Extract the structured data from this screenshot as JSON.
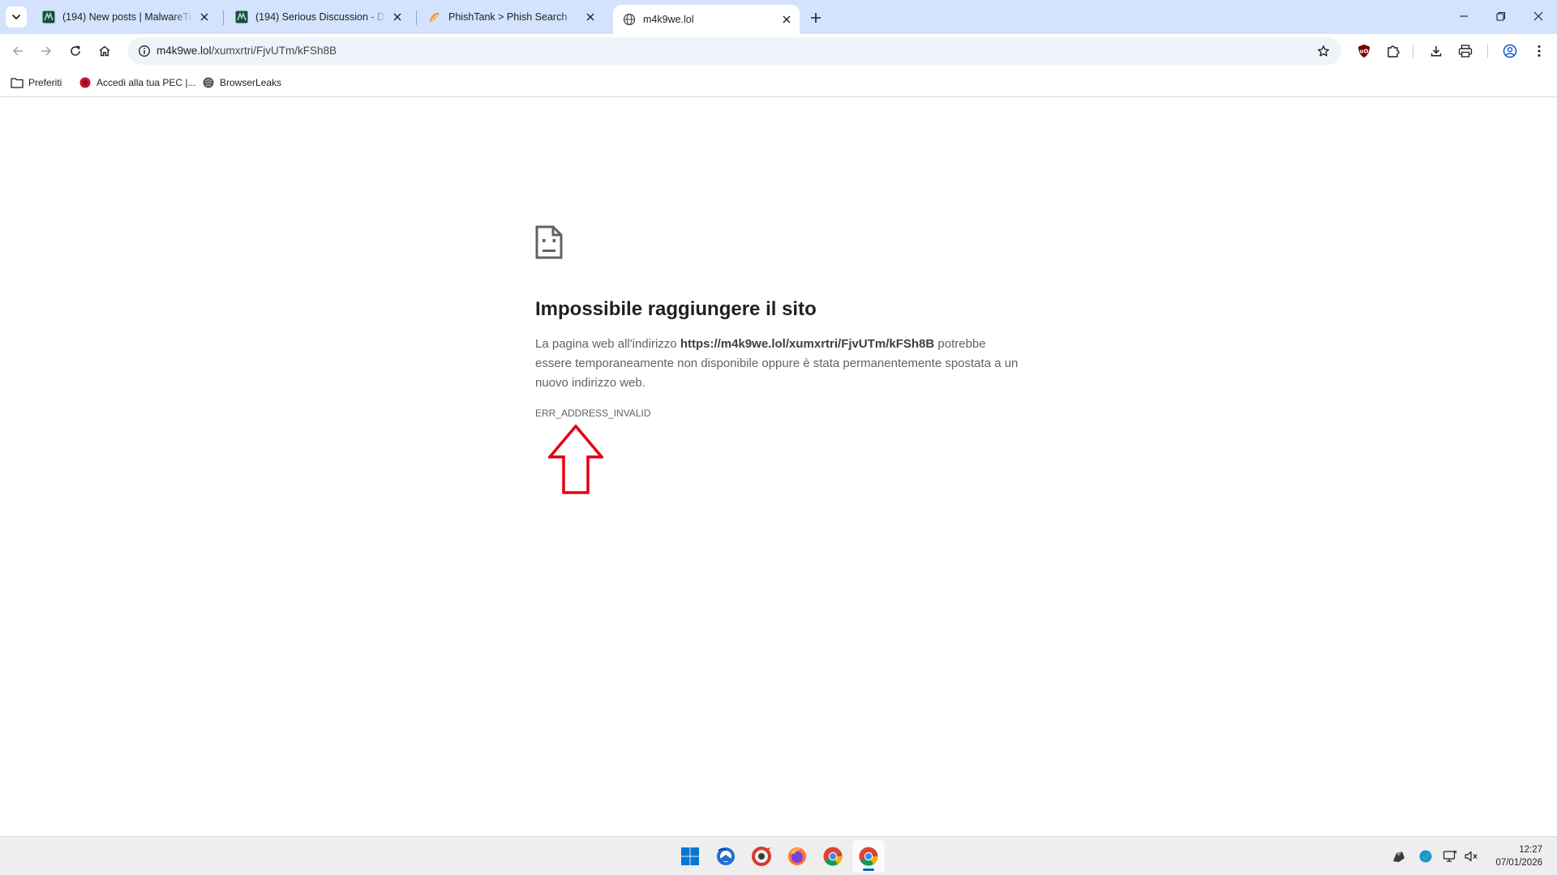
{
  "browser": {
    "tabs": [
      {
        "title": "(194) New posts | MalwareTips",
        "favicon": "malwaretips-icon"
      },
      {
        "title": "(194) Serious Discussion - DNS",
        "favicon": "malwaretips-icon"
      },
      {
        "title": "PhishTank > Phish Search",
        "favicon": "phishtank-icon"
      },
      {
        "title": "m4k9we.lol",
        "favicon": "globe-icon",
        "active": true
      }
    ],
    "address_bar": {
      "host": "m4k9we.lol",
      "path": "/xumxrtri/FjvUTm/kFSh8B"
    },
    "bookmarks": [
      {
        "label": "Preferiti",
        "icon": "folder-icon"
      },
      {
        "label": "Accedi alla tua PEC |...",
        "icon": "pec-icon"
      },
      {
        "label": "BrowserLeaks",
        "icon": "browserleaks-icon"
      }
    ]
  },
  "error_page": {
    "title": "Impossibile raggiungere il sito",
    "body_prefix": "La pagina web all'indirizzo ",
    "url": "https://m4k9we.lol/xumxrtri/FjvUTm/kFSh8B",
    "body_suffix": " potrebbe essere temporaneamente non disponibile oppure è stata permanentemente spostata a un nuovo indirizzo web.",
    "error_code": "ERR_ADDRESS_INVALID"
  },
  "annotation": {
    "arrow_color": "#e3000f"
  },
  "taskbar": {
    "apps": [
      "windows-start-icon",
      "thunderbird-icon",
      "ccleaner-icon",
      "firefox-icon",
      "chrome-icon",
      "chrome-active-icon"
    ],
    "clock": {
      "time": "12:27",
      "date": "07/01/2026"
    }
  },
  "colors": {
    "tabstrip": "#d3e3fd",
    "omnibox": "#eff3fa",
    "accent": "#0b57d0"
  }
}
